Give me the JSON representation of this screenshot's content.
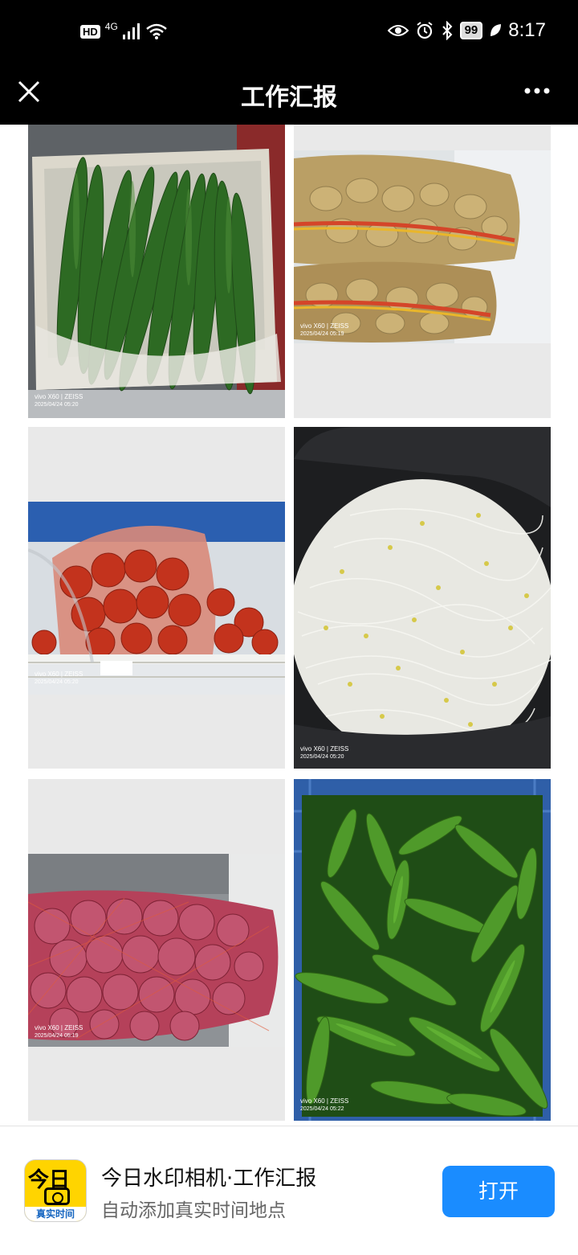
{
  "status_bar": {
    "hd": "HD",
    "network": "4G",
    "battery": "99",
    "time": "8:17"
  },
  "nav": {
    "title": "工作汇报",
    "close_icon": "close-icon",
    "more_icon": "more-icon"
  },
  "photos": [
    {
      "subject": "cucumbers",
      "watermark": "vivo X60 | ZEISS",
      "datetime": "2025/04/24 05:20"
    },
    {
      "subject": "potatoes",
      "watermark": "vivo X60 | ZEISS",
      "datetime": "2025/04/24 05:19"
    },
    {
      "subject": "tomatoes",
      "watermark": "vivo X60 | ZEISS",
      "datetime": "2025/04/24 05:20"
    },
    {
      "subject": "bean-sprouts",
      "watermark": "vivo X60 | ZEISS",
      "datetime": "2025/04/24 05:20"
    },
    {
      "subject": "onions",
      "watermark": "vivo X60 | ZEISS",
      "datetime": "2025/04/24 05:19"
    },
    {
      "subject": "green-peppers",
      "watermark": "vivo X60 | ZEISS",
      "datetime": "2025/04/24 05:22"
    }
  ],
  "banner": {
    "icon_text": "今日",
    "icon_sub": "真实时间",
    "app_name": "今日水印相机·工作汇报",
    "description": "自动添加真实时间地点",
    "open_label": "打开"
  }
}
